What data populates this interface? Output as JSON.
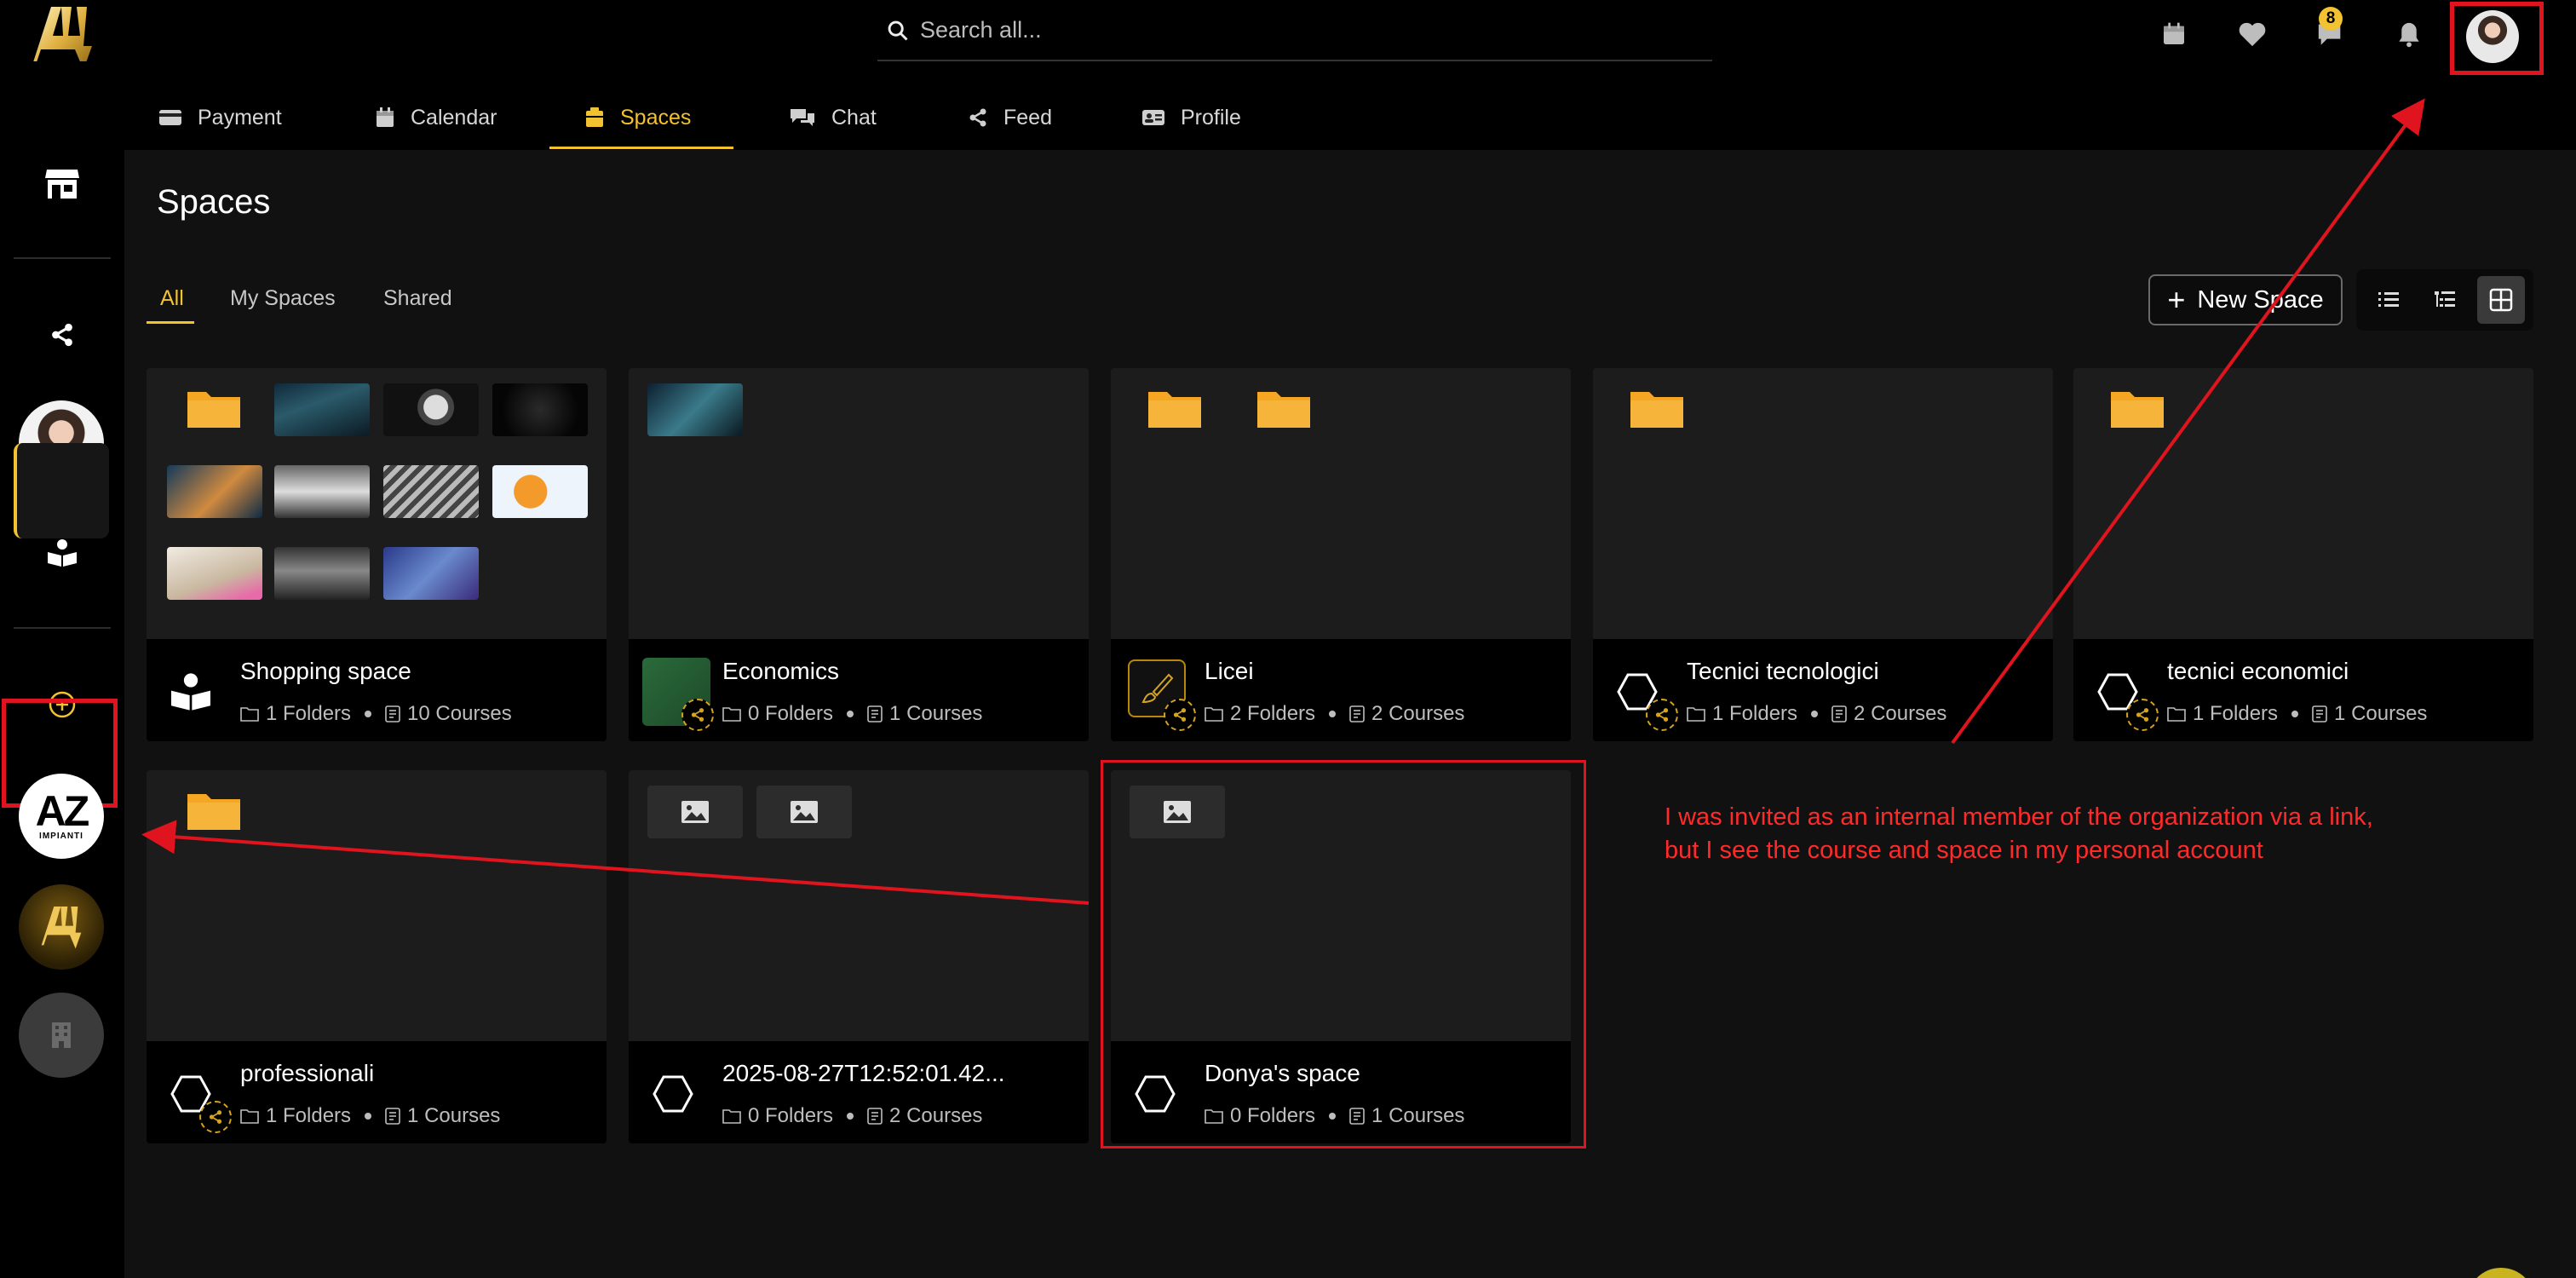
{
  "search": {
    "placeholder": "Search all..."
  },
  "header": {
    "chat_badge": "8"
  },
  "nav": {
    "tabs": [
      {
        "label": "Payment",
        "icon": "credit-card-icon"
      },
      {
        "label": "Calendar",
        "icon": "calendar-icon"
      },
      {
        "label": "Spaces",
        "icon": "spaces-icon",
        "active": true
      },
      {
        "label": "Chat",
        "icon": "chat-bubbles-icon"
      },
      {
        "label": "Feed",
        "icon": "share-icon"
      },
      {
        "label": "Profile",
        "icon": "id-card-icon"
      }
    ]
  },
  "page": {
    "title": "Spaces",
    "filters": [
      {
        "label": "All",
        "active": true
      },
      {
        "label": "My Spaces"
      },
      {
        "label": "Shared"
      }
    ],
    "new_space_label": "New Space"
  },
  "spaces": [
    {
      "title": "Shopping space",
      "folders": "1 Folders",
      "courses": "10 Courses"
    },
    {
      "title": "Economics",
      "folders": "0 Folders",
      "courses": "1 Courses"
    },
    {
      "title": "Licei",
      "folders": "2 Folders",
      "courses": "2 Courses"
    },
    {
      "title": "Tecnici tecnologici",
      "folders": "1 Folders",
      "courses": "2 Courses"
    },
    {
      "title": "tecnici economici",
      "folders": "1 Folders",
      "courses": "1 Courses"
    },
    {
      "title": "professionali",
      "folders": "1 Folders",
      "courses": "1 Courses"
    },
    {
      "title": "2025-08-27T12:52:01.42...",
      "folders": "0 Folders",
      "courses": "2 Courses"
    },
    {
      "title": "Donya's space",
      "folders": "0 Folders",
      "courses": "1 Courses"
    }
  ],
  "rail": {
    "org_logo_text": "AZ",
    "org_logo_sub": "IMPIANTI"
  },
  "annotation": {
    "line1": "I was invited as an internal member of the organization via a link,",
    "line2": "but I see the course and space in my personal account"
  },
  "colors": {
    "accent": "#f2c230",
    "annotation_red": "#e0141e",
    "folder_orange": "#f5a623"
  }
}
